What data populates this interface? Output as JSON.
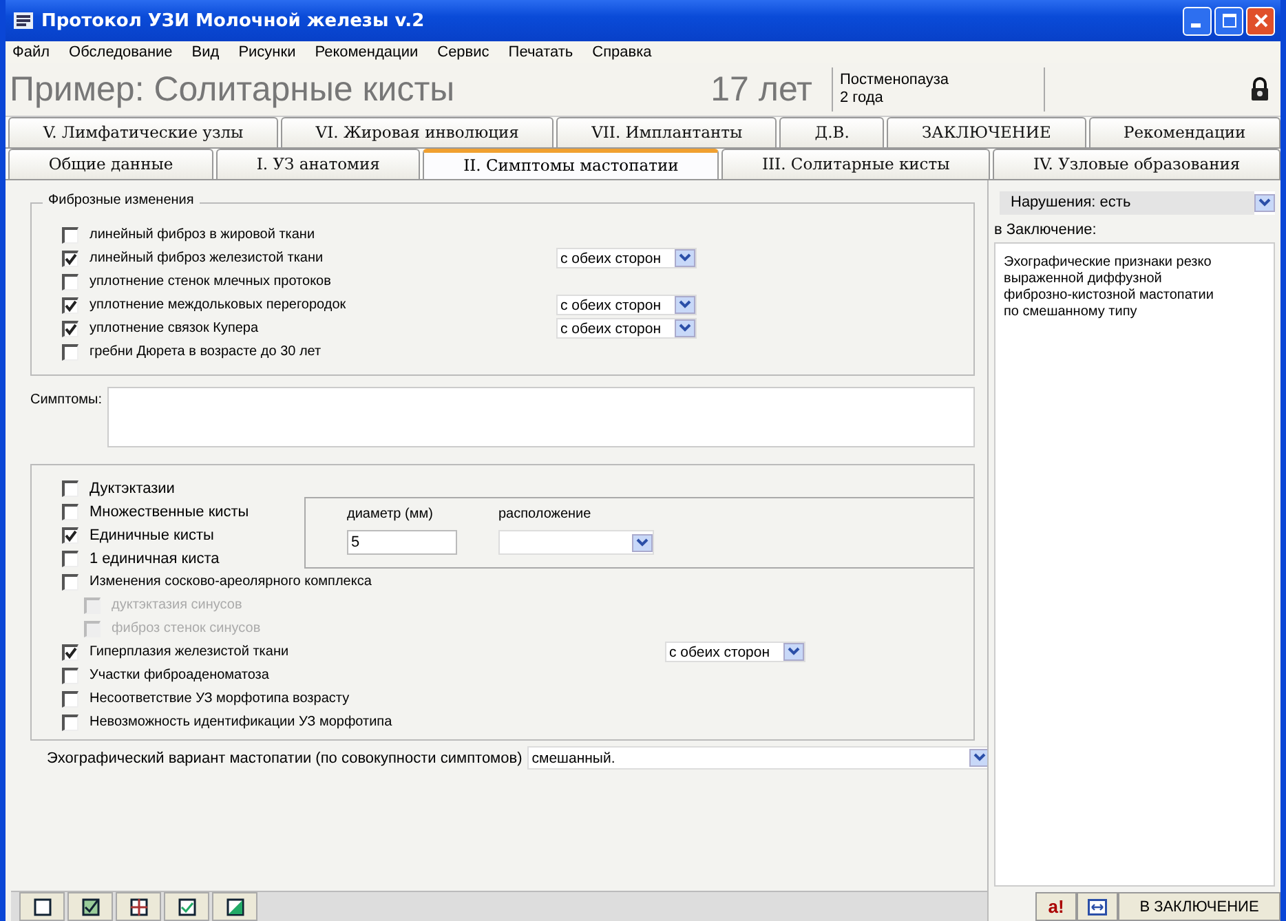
{
  "window": {
    "title": "Протокол УЗИ Молочной железы v.2"
  },
  "menu": [
    "Файл",
    "Обследование",
    "Вид",
    "Рисунки",
    "Рекомендации",
    "Сервис",
    "Печатать",
    "Справка"
  ],
  "header": {
    "patient": "Пример: Солитарные кисты",
    "age": "17 лет",
    "status_lines": [
      "Постменопауза",
      "2 года"
    ]
  },
  "tabs_row1": [
    {
      "label": "V. Лимфатические узлы",
      "selected": false
    },
    {
      "label": "VI. Жировая инволюция",
      "selected": false
    },
    {
      "label": "VII. Имплантанты",
      "selected": false
    },
    {
      "label": "Д.В.",
      "selected": false
    },
    {
      "label": "ЗАКЛЮЧЕНИЕ",
      "selected": false
    },
    {
      "label": "Рекомендации",
      "selected": false
    }
  ],
  "tabs_row2": [
    {
      "label": "Общие данные",
      "selected": false
    },
    {
      "label": "I. УЗ анатомия",
      "selected": false
    },
    {
      "label": "II. Симптомы мастопатии",
      "selected": true
    },
    {
      "label": "III. Солитарные кисты",
      "selected": false
    },
    {
      "label": "IV. Узловые образования",
      "selected": false
    }
  ],
  "fibrosis": {
    "legend": "Фиброзные изменения",
    "items": [
      {
        "label": "линейный фиброз в жировой ткани",
        "checked": false
      },
      {
        "label": "линейный фиброз железистой ткани",
        "checked": true,
        "side": "с обеих сторон"
      },
      {
        "label": "уплотнение стенок млечных протоков",
        "checked": false
      },
      {
        "label": "уплотнение междольковых перегородок",
        "checked": true,
        "side": "с обеих сторон"
      },
      {
        "label": "уплотнение связок Купера",
        "checked": true,
        "side": "с обеих сторон"
      },
      {
        "label": "гребни Дюрета в возрасте до 30 лет",
        "checked": false
      }
    ]
  },
  "symptoms": {
    "label": "Симптомы:"
  },
  "findings": {
    "top_items": [
      {
        "label": "Дуктэктазии",
        "checked": false,
        "disabled": false
      },
      {
        "label": "Множественные кисты",
        "checked": false,
        "disabled": false
      },
      {
        "label": "Единичные кисты",
        "checked": true,
        "disabled": false
      },
      {
        "label": "1 единичная киста",
        "checked": false,
        "disabled": false
      }
    ],
    "cyst_details": {
      "diameter_label": "диаметр (мм)",
      "diameter_value": "5",
      "location_label": "расположение"
    },
    "items": [
      {
        "label": "Изменения сосково-ареолярного комплекса",
        "checked": false,
        "disabled": false,
        "children": [
          {
            "label": "дуктэктазия синусов",
            "checked": false,
            "disabled": true
          },
          {
            "label": "фиброз стенок синусов",
            "checked": false,
            "disabled": true
          }
        ]
      },
      {
        "label": "Гиперплазия железистой ткани",
        "checked": true,
        "disabled": false,
        "side": "с обеих сторон"
      },
      {
        "label": "Участки фиброаденоматоза",
        "checked": false,
        "disabled": false
      },
      {
        "label": "Несоответствие УЗ морфотипа возрасту",
        "checked": false,
        "disabled": false
      },
      {
        "label": "Невозможность идентификации УЗ морфотипа",
        "checked": false,
        "disabled": false
      }
    ]
  },
  "variant": {
    "label": "Эхографический вариант мастопатии (по совокупности симптомов)",
    "value": "смешанный."
  },
  "side_panel": {
    "violations_label": "Нарушения:",
    "violations_value": "есть",
    "conclusion_label": "в Заключение:",
    "conclusion_text": "Эхографические признаки резко выраженной диффузной фиброзно-кистозной мастопатии по смешанному типу",
    "mark_button": "a!",
    "apply_button": "В ЗАКЛЮЧЕНИЕ"
  }
}
